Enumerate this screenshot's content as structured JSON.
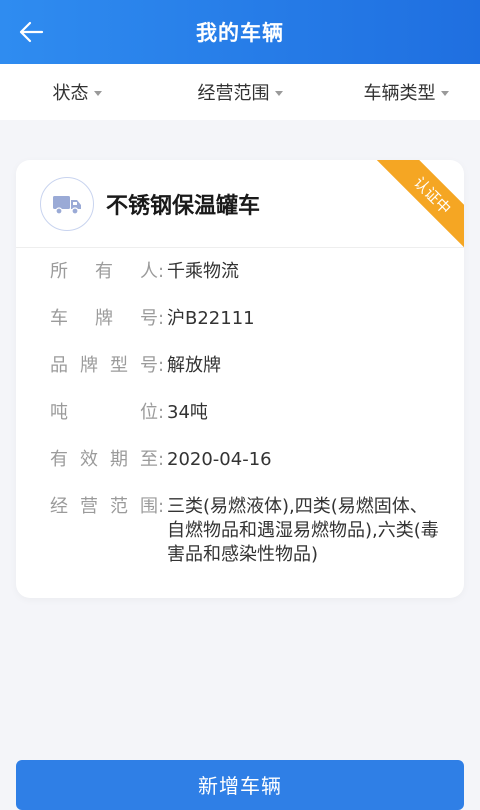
{
  "header": {
    "title": "我的车辆",
    "back_icon": "arrow-left-icon"
  },
  "filters": [
    {
      "label": "状态",
      "icon": "caret-down-icon"
    },
    {
      "label": "经营范围",
      "icon": "caret-down-icon"
    },
    {
      "label": "车辆类型",
      "icon": "caret-down-icon"
    }
  ],
  "vehicle_card": {
    "icon": "truck-icon",
    "name": "不锈钢保温罐车",
    "status_ribbon": "认证中",
    "fields": [
      {
        "label": "所有人",
        "value": "千乘物流"
      },
      {
        "label": "车牌号",
        "value": "沪B22111"
      },
      {
        "label": "品牌型号",
        "value": "解放牌"
      },
      {
        "label": "吨位",
        "value": "34吨"
      },
      {
        "label": "有效期至",
        "value": "2020-04-16"
      },
      {
        "label": "经营范围",
        "value": "三类(易燃液体),四类(易燃固体、自燃物品和遇湿易燃物品),六类(毒害品和感染性物品)"
      }
    ]
  },
  "footer": {
    "add_button_label": "新增车辆"
  },
  "colors": {
    "header_bg": "#2f8cf0",
    "ribbon": "#f5a623",
    "button": "#2f7fe6",
    "label_gray": "#9b9b9b"
  }
}
